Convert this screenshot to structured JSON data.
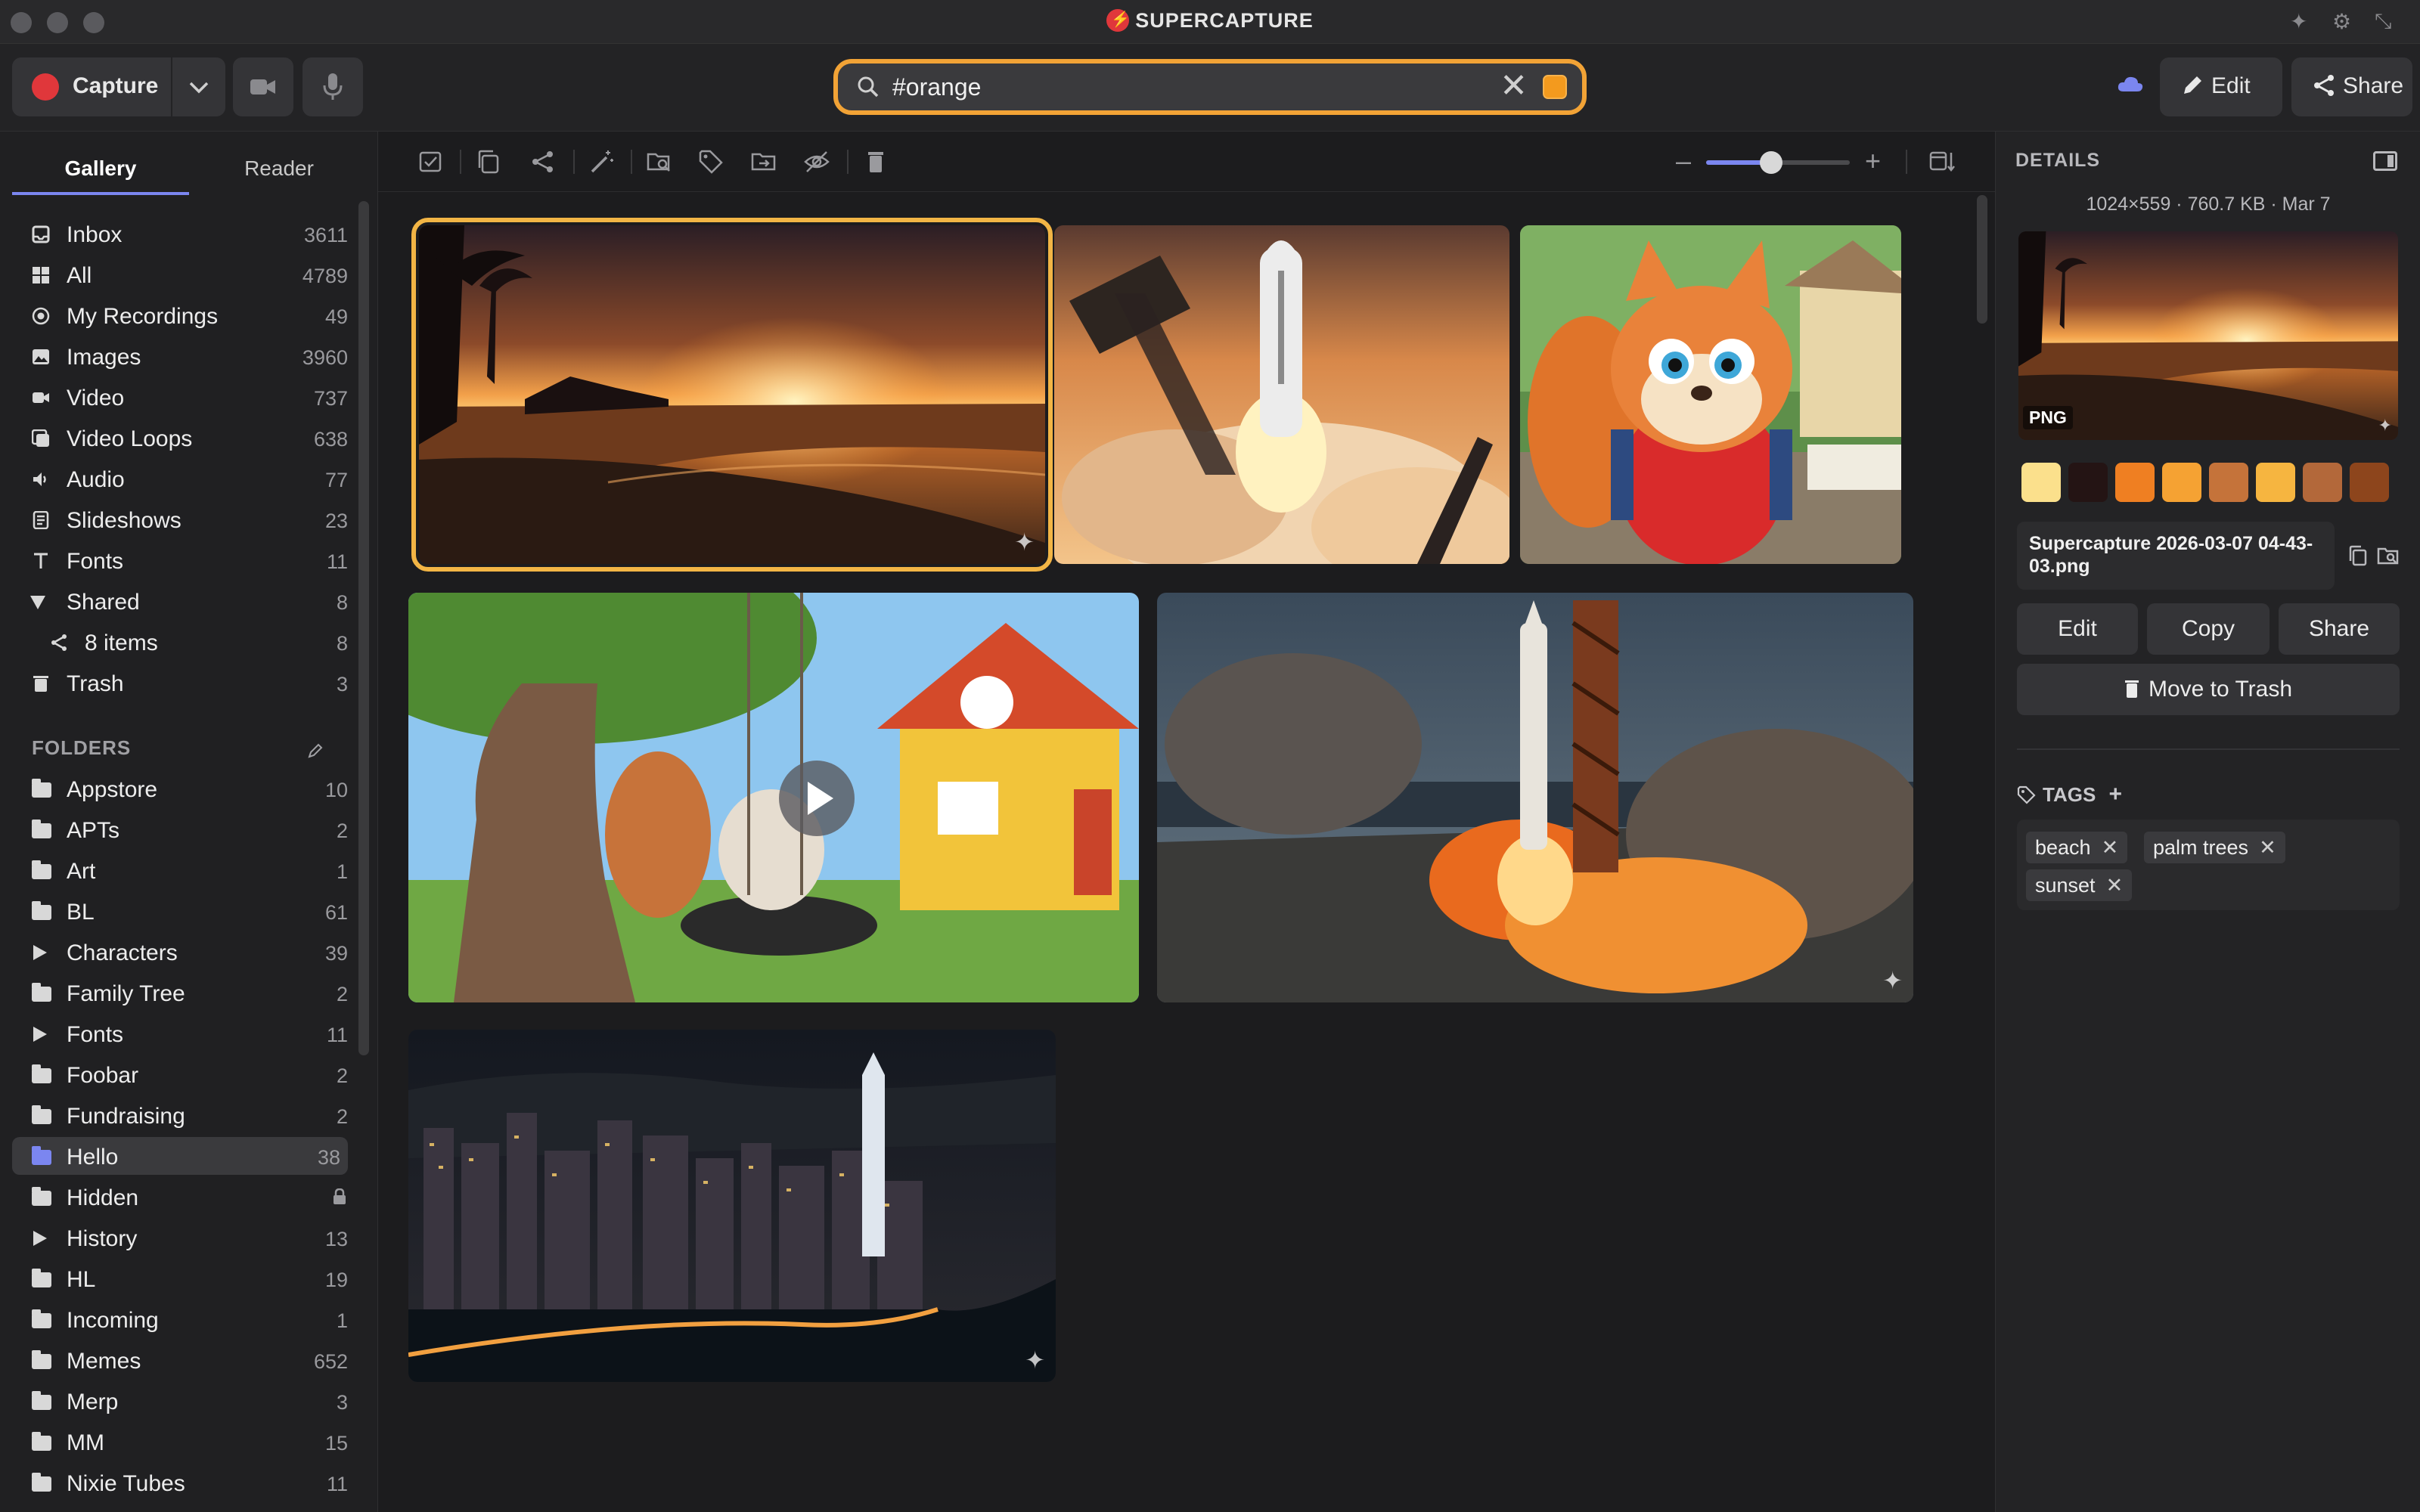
{
  "app": {
    "title": "SUPERCAPTURE"
  },
  "toolbar": {
    "capture_label": "Capture",
    "search_value": "#orange",
    "search_color": "#f39a1e",
    "edit_label": "Edit",
    "share_label": "Share"
  },
  "sidebar": {
    "tabs": [
      "Gallery",
      "Reader"
    ],
    "active_tab": "Gallery",
    "library": [
      {
        "label": "Inbox",
        "count": "3611",
        "icon": "inbox-icon"
      },
      {
        "label": "All",
        "count": "4789",
        "icon": "grid-icon"
      },
      {
        "label": "My Recordings",
        "count": "49",
        "icon": "record-icon"
      },
      {
        "label": "Images",
        "count": "3960",
        "icon": "image-icon"
      },
      {
        "label": "Video",
        "count": "737",
        "icon": "video-icon"
      },
      {
        "label": "Video Loops",
        "count": "638",
        "icon": "video-loop-icon"
      },
      {
        "label": "Audio",
        "count": "77",
        "icon": "speaker-icon"
      },
      {
        "label": "Slideshows",
        "count": "23",
        "icon": "slideshow-icon"
      },
      {
        "label": "Fonts",
        "count": "11",
        "icon": "font-icon"
      },
      {
        "label": "Shared",
        "count": "8",
        "icon": "disclosure-open-icon"
      },
      {
        "label": "8 items",
        "count": "8",
        "icon": "share-icon"
      },
      {
        "label": "Trash",
        "count": "3",
        "icon": "trash-icon"
      }
    ],
    "folders_header": "FOLDERS",
    "folders": [
      {
        "label": "Appstore",
        "count": "10",
        "kind": "folder"
      },
      {
        "label": "APTs",
        "count": "2",
        "kind": "folder"
      },
      {
        "label": "Art",
        "count": "1",
        "kind": "folder"
      },
      {
        "label": "BL",
        "count": "61",
        "kind": "folder"
      },
      {
        "label": "Characters",
        "count": "39",
        "kind": "group"
      },
      {
        "label": "Family Tree",
        "count": "2",
        "kind": "folder"
      },
      {
        "label": "Fonts",
        "count": "11",
        "kind": "group"
      },
      {
        "label": "Foobar",
        "count": "2",
        "kind": "folder"
      },
      {
        "label": "Fundraising",
        "count": "2",
        "kind": "folder"
      },
      {
        "label": "Hello",
        "count": "38",
        "kind": "folder",
        "selected": true
      },
      {
        "label": "Hidden",
        "count": "",
        "kind": "folder",
        "locked": true
      },
      {
        "label": "History",
        "count": "13",
        "kind": "group"
      },
      {
        "label": "HL",
        "count": "19",
        "kind": "folder"
      },
      {
        "label": "Incoming",
        "count": "1",
        "kind": "folder"
      },
      {
        "label": "Memes",
        "count": "652",
        "kind": "folder"
      },
      {
        "label": "Merp",
        "count": "3",
        "kind": "folder"
      },
      {
        "label": "MM",
        "count": "15",
        "kind": "folder"
      },
      {
        "label": "Nixie Tubes",
        "count": "11",
        "kind": "folder"
      }
    ]
  },
  "gallery": {
    "zoom_fraction": 0.45,
    "items": [
      {
        "name": "sunset-beach",
        "selected": true
      },
      {
        "name": "rocket-launch-clouds"
      },
      {
        "name": "squirrel-character"
      },
      {
        "name": "squirrel-tire-swing-video",
        "video": true
      },
      {
        "name": "rocket-launch-pad"
      },
      {
        "name": "city-night-skyline"
      }
    ]
  },
  "details": {
    "header": "DETAILS",
    "meta": "1024×559 · 760.7 KB · Mar 7",
    "format_badge": "PNG",
    "palette": [
      "#fbe08c",
      "#241414",
      "#ef7f22",
      "#f5a233",
      "#c5733a",
      "#f6b540",
      "#b3683a",
      "#8d451c"
    ],
    "filename": "Supercapture 2026-03-07 04-43-03.png",
    "buttons": [
      "Edit",
      "Copy",
      "Share"
    ],
    "trash_label": "Move to Trash",
    "tags_header": "TAGS",
    "tags": [
      "beach",
      "palm trees",
      "sunset"
    ]
  }
}
